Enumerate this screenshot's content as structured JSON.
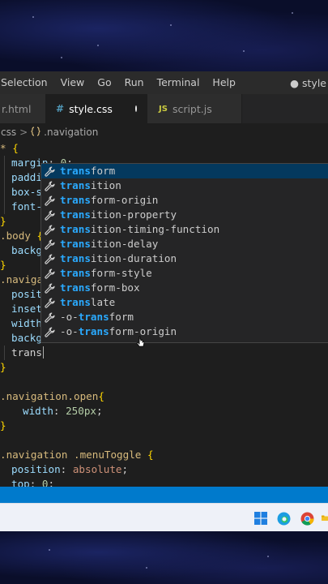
{
  "menubar": {
    "items": [
      "Selection",
      "View",
      "Go",
      "Run",
      "Terminal",
      "Help"
    ],
    "right_label": "● style"
  },
  "tabs": [
    {
      "label": "r.html",
      "icon": "html-file-icon"
    },
    {
      "label": "style.css",
      "icon": "css-hash-icon",
      "active": true,
      "modified": true
    },
    {
      "label": "script.js",
      "icon": "js-file-icon"
    }
  ],
  "tab_glyphs": {
    "hash": "#",
    "js": "JS"
  },
  "breadcrumb": {
    "file": "css",
    "separator": ">",
    "symbol": ".navigation"
  },
  "code": {
    "l1_sel": "*",
    "l1_brace": "{",
    "l2_prop": "margin",
    "l2_colon": ": ",
    "l2_val": "0",
    "l2_semi": ";",
    "l3_prop": "paddi",
    "l4_prop": "box-s",
    "l5_prop": "font-",
    "l6_brace": "}",
    "l7_sel": ".body",
    "l7_brace": "{",
    "l8_prop": "backg",
    "l9_brace": "}",
    "l10_sel": ".naviga",
    "l11_prop": "posit",
    "l12_prop": "inset",
    "l13_prop": "width",
    "l14_prop": "backg",
    "l15_text": "trans",
    "l16_brace": "}",
    "l18_sel": ".navigation.open",
    "l18_brace": "{",
    "l19_prop": "width",
    "l19_colon": ": ",
    "l19_val": "250px",
    "l19_semi": ";",
    "l20_brace": "}",
    "l22_sel": ".navigation .menuToggle",
    "l22_brace": "{",
    "l23_prop": "position",
    "l23_colon": ": ",
    "l23_val": "absolute",
    "l23_semi": ";",
    "l24_prop": "top",
    "l24_colon": ": ",
    "l24_val": "0",
    "l24_semi": ";"
  },
  "suggestions": [
    {
      "match": "trans",
      "rest": "form",
      "pre": ""
    },
    {
      "match": "trans",
      "rest": "ition",
      "pre": ""
    },
    {
      "match": "trans",
      "rest": "form-origin",
      "pre": ""
    },
    {
      "match": "trans",
      "rest": "ition-property",
      "pre": ""
    },
    {
      "match": "trans",
      "rest": "ition-timing-function",
      "pre": ""
    },
    {
      "match": "trans",
      "rest": "ition-delay",
      "pre": ""
    },
    {
      "match": "trans",
      "rest": "ition-duration",
      "pre": ""
    },
    {
      "match": "trans",
      "rest": "form-style",
      "pre": ""
    },
    {
      "match": "trans",
      "rest": "form-box",
      "pre": ""
    },
    {
      "match": "trans",
      "rest": "late",
      "pre": ""
    },
    {
      "match": "trans",
      "rest": "form",
      "pre": "-o-"
    },
    {
      "match": "trans",
      "rest": "form-origin",
      "pre": "-o-"
    }
  ],
  "colors": {
    "accent": "#007acc",
    "editor_bg": "#1e1e1e",
    "selection": "#04395e",
    "match_highlight": "#2aaaff"
  }
}
